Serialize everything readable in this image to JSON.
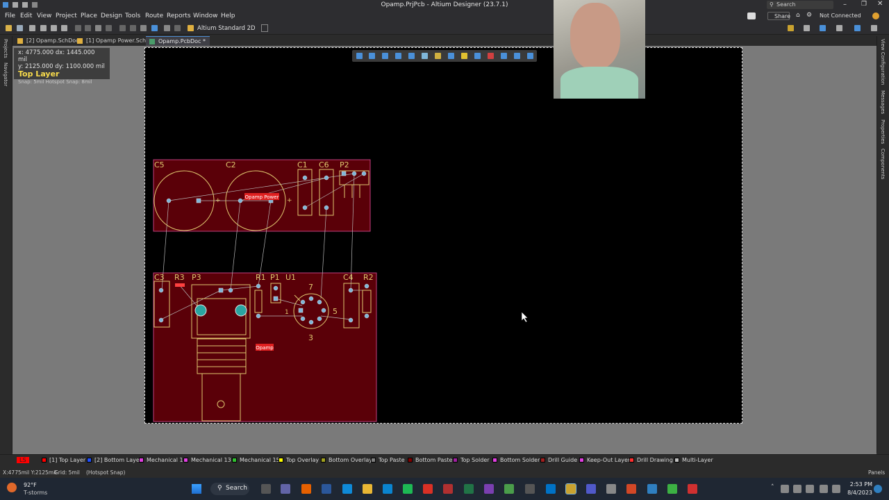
{
  "window": {
    "title": "Opamp.PrjPcb - Altium Designer (23.7.1)",
    "search_placeholder": "Search"
  },
  "menu": [
    "File",
    "Edit",
    "View",
    "Project",
    "Place",
    "Design",
    "Tools",
    "Route",
    "Reports",
    "Window",
    "Help"
  ],
  "right_header": {
    "share": "Share",
    "connection": "Not Connected"
  },
  "toolbar": {
    "view_mode": "Altium Standard 2D"
  },
  "tabs": [
    {
      "label": "[2] Opamp.SchDoc"
    },
    {
      "label": "[1] Opamp Power.SchDoc"
    },
    {
      "label": "Opamp.PcbDoc *"
    }
  ],
  "left_panels": [
    "Projects",
    "Navigator"
  ],
  "right_panels": [
    "View Configuration",
    "Messages",
    "Properties",
    "Components"
  ],
  "coords": {
    "line1": "x: 4775.000  dx: 1445.000 mil",
    "line2": "y: 2125.000  dy: 1100.000 mil",
    "layer": "Top Layer",
    "snap": "Snap: 5mil Hotspot Snap: 8mil"
  },
  "pcb": {
    "room_top": "Opamp Power",
    "room_bottom": "Opamp",
    "designators_top": [
      "C5",
      "C2",
      "C1",
      "C6",
      "P2"
    ],
    "designators_bottom": [
      "C3",
      "R3",
      "P3",
      "R1",
      "P1",
      "U1",
      "C4",
      "R2"
    ],
    "pin_labels": [
      "7",
      "1",
      "5",
      "3"
    ]
  },
  "layers": [
    {
      "name": "LS",
      "color": "#ff0000"
    },
    {
      "name": "[1] Top Layer",
      "color": "#ff0000"
    },
    {
      "name": "[2] Bottom Layer",
      "color": "#1f4fff"
    },
    {
      "name": "Mechanical 1",
      "color": "#e040e0"
    },
    {
      "name": "Mechanical 13",
      "color": "#e040e0"
    },
    {
      "name": "Mechanical 15",
      "color": "#30c030"
    },
    {
      "name": "Top Overlay",
      "color": "#ffff00"
    },
    {
      "name": "Bottom Overlay",
      "color": "#a0a020"
    },
    {
      "name": "Top Paste",
      "color": "#808080"
    },
    {
      "name": "Bottom Paste",
      "color": "#800000"
    },
    {
      "name": "Top Solder",
      "color": "#a020a0"
    },
    {
      "name": "Bottom Solder",
      "color": "#e040e0"
    },
    {
      "name": "Drill Guide",
      "color": "#a02020"
    },
    {
      "name": "Keep-Out Layer",
      "color": "#e040e0"
    },
    {
      "name": "Drill Drawing",
      "color": "#ff3030"
    },
    {
      "name": "Multi-Layer",
      "color": "#c0c0c0"
    }
  ],
  "panels_button": "Panels",
  "status": {
    "coords": "X:4775mil Y:2125mil",
    "grid": "Grid: 5mil",
    "snap": "(Hotspot Snap)"
  },
  "taskbar": {
    "weather_temp": "92°F",
    "weather_desc": "T-storms",
    "search": "Search",
    "time": "2:53 PM",
    "date": "8/4/2023"
  }
}
